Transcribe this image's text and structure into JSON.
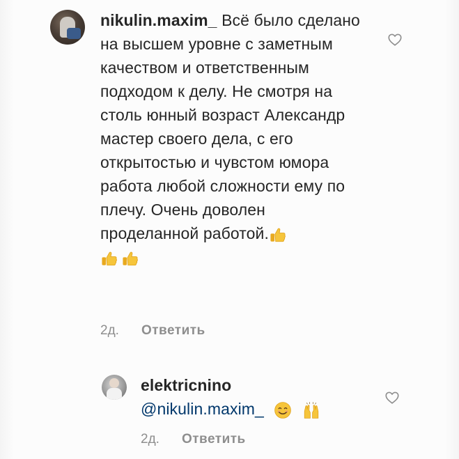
{
  "comments": [
    {
      "username": "nikulin.maxim_",
      "text": "Всё было сделано на высшем уровне с заметным качеством и ответственным подходом к делу. Не смотря на столь юнный возраст Александр мастер своего дела, с его открытостью и чувстом юмора работа любой сложности ему по плечу. Очень доволен проделанной работой.",
      "emojis": [
        "thumbs-up",
        "thumbs-up",
        "thumbs-up"
      ],
      "time": "2д.",
      "reply_label": "Ответить"
    }
  ],
  "replies": [
    {
      "username": "elektricnino",
      "mention": "@nikulin.maxim_",
      "emojis": [
        "smiling-face",
        "raised-hands"
      ],
      "time": "2д.",
      "reply_label": "Ответить"
    }
  ],
  "colors": {
    "text": "#262626",
    "secondary": "#8e8e8e",
    "mention": "#00376b",
    "emoji_yellow": "#f6c53b"
  }
}
